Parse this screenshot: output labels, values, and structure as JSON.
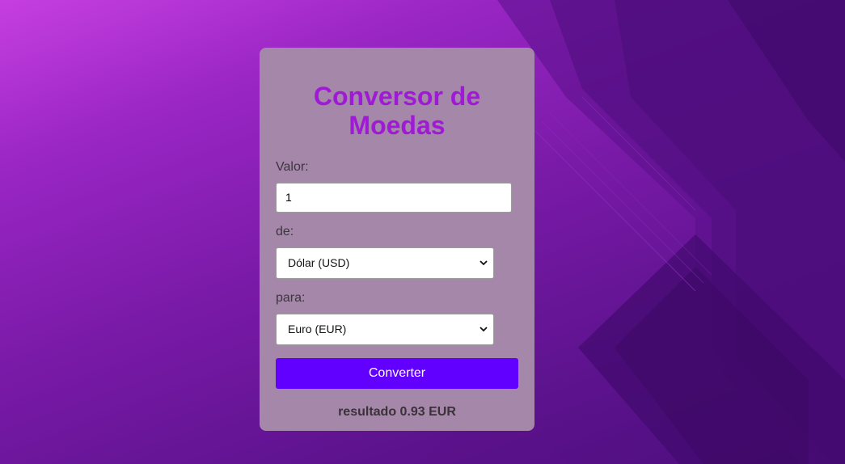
{
  "colors": {
    "title": "#a01ad6",
    "card_background": "#a487a9",
    "button_background": "#6200ff",
    "button_text": "#ffffff"
  },
  "form": {
    "title": "Conversor de Moedas",
    "amount_label": "Valor:",
    "amount_value": "1",
    "from_label": "de:",
    "from_selected": "Dólar (USD)",
    "to_label": "para:",
    "to_selected": "Euro (EUR)",
    "convert_button": "Converter",
    "result_text": "resultado 0.93 EUR"
  },
  "icons": {
    "dropdown": "chevron-down-icon"
  }
}
